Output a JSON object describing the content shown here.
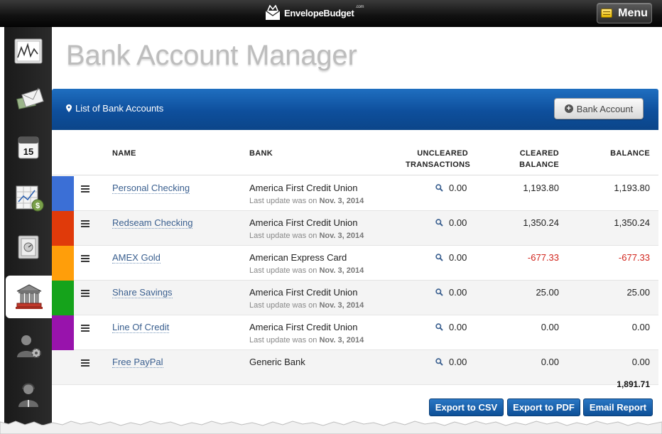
{
  "app": {
    "brand": "EnvelopeBudget",
    "brand_suffix": ".com",
    "menu_label": "Menu"
  },
  "sidebar": {
    "items": [
      {
        "name": "reports",
        "icon": "chart-icon"
      },
      {
        "name": "envelopes",
        "icon": "envelope-money-icon"
      },
      {
        "name": "calendar",
        "icon": "calendar-icon",
        "label": "15"
      },
      {
        "name": "budget",
        "icon": "spreadsheet-dollar-icon"
      },
      {
        "name": "vault",
        "icon": "safe-icon"
      },
      {
        "name": "bank-accounts",
        "icon": "bank-icon",
        "active": true
      },
      {
        "name": "user-settings",
        "icon": "user-gear-icon"
      },
      {
        "name": "support",
        "icon": "user-headset-icon"
      }
    ]
  },
  "page": {
    "title": "Bank Account Manager"
  },
  "panel": {
    "title": "List of Bank Accounts",
    "add_button": "Bank Account"
  },
  "table": {
    "headers": {
      "name": "NAME",
      "bank": "BANK",
      "uncleared_1": "UNCLEARED",
      "uncleared_2": "TRANSACTIONS",
      "cleared_1": "CLEARED",
      "cleared_2": "BALANCE",
      "balance": "BALANCE"
    },
    "update_prefix": "Last update was on",
    "rows": [
      {
        "name": "Personal Checking",
        "bank": "America First Credit Union",
        "updated": "Nov. 3, 2014",
        "uncleared": "0.00",
        "cleared": "1,193.80",
        "balance": "1,193.80",
        "color": "#3b6fd6"
      },
      {
        "name": "Redseam Checking",
        "bank": "America First Credit Union",
        "updated": "Nov. 3, 2014",
        "uncleared": "0.00",
        "cleared": "1,350.24",
        "balance": "1,350.24",
        "color": "#e03a0a"
      },
      {
        "name": "AMEX Gold",
        "bank": "American Express Card",
        "updated": "Nov. 3, 2014",
        "uncleared": "0.00",
        "cleared": "-677.33",
        "balance": "-677.33",
        "color": "#ff9e0a"
      },
      {
        "name": "Share Savings",
        "bank": "America First Credit Union",
        "updated": "Nov. 3, 2014",
        "uncleared": "0.00",
        "cleared": "25.00",
        "balance": "25.00",
        "color": "#15a31b"
      },
      {
        "name": "Line Of Credit",
        "bank": "America First Credit Union",
        "updated": "Nov. 3, 2014",
        "uncleared": "0.00",
        "cleared": "0.00",
        "balance": "0.00",
        "color": "#9813ac"
      },
      {
        "name": "Free PayPal",
        "bank": "Generic Bank",
        "updated": "",
        "uncleared": "0.00",
        "cleared": "0.00",
        "balance": "0.00",
        "color": ""
      }
    ],
    "total": "1,891.71"
  },
  "actions": {
    "export_csv": "Export to CSV",
    "export_pdf": "Export to PDF",
    "email_report": "Email Report"
  },
  "colors": {
    "header_blue": "#0e4f9c",
    "negative": "#d1241c",
    "link": "#3a5f8f"
  }
}
